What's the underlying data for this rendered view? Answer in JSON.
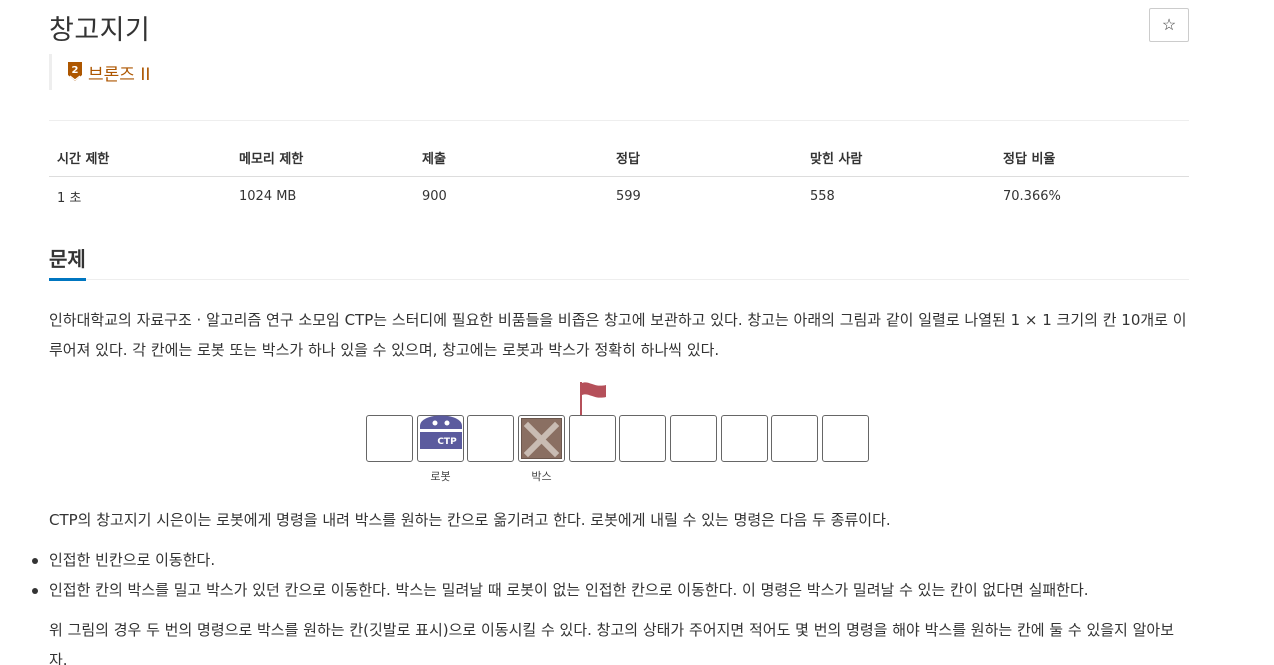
{
  "problem": {
    "title": "창고지기",
    "star_symbol": "☆",
    "tier": {
      "number": "2",
      "label": "브론즈 II",
      "color": "#ad5600"
    }
  },
  "info_table": {
    "headers": [
      "시간 제한",
      "메모리 제한",
      "제출",
      "정답",
      "맞힌 사람",
      "정답 비율"
    ],
    "values": [
      "1 초",
      "1024 MB",
      "900",
      "599",
      "558",
      "70.366%"
    ]
  },
  "section": {
    "title": "문제",
    "accent_color": "#0076c0"
  },
  "paragraphs": {
    "p1": "인하대학교의 자료구조 · 알고리즘 연구 소모임 CTP는 스터디에 필요한 비품들을 비좁은 창고에 보관하고 있다. 창고는 아래의 그림과 같이 일렬로 나열된 1 × 1 크기의 칸 10개로 이루어져 있다. 각 칸에는 로봇 또는 박스가 하나 있을 수 있으며, 창고에는 로봇과 박스가 정확히 하나씩 있다.",
    "p2": "CTP의 창고지기 시은이는 로봇에게 명령을 내려 박스를 원하는 칸으로 옮기려고 한다. 로봇에게 내릴 수 있는 명령은 다음 두 종류이다.",
    "p3": "위 그림의 경우 두 번의 명령으로 박스를 원하는 칸(깃발로 표시)으로 이동시킬 수 있다. 창고의 상태가 주어지면 적어도 몇 번의 명령을 해야 박스를 원하는 칸에 둘 수 있을지 알아보자."
  },
  "figure": {
    "cell_count": 10,
    "robot_cell": 2,
    "box_cell": 4,
    "flag_cell": 5,
    "robot_text": "CTP",
    "robot_label": "로봇",
    "box_label": "박스",
    "robot_color": "#5b5b9e",
    "box_color": "#8a6f62",
    "flag_color": "#b5505a"
  },
  "bullets": [
    "인접한 빈칸으로 이동한다.",
    "인접한 칸의 박스를 밀고 박스가 있던 칸으로 이동한다. 박스는 밀려날 때 로봇이 없는 인접한 칸으로 이동한다. 이 명령은 박스가 밀려날 수 있는 칸이 없다면 실패한다."
  ]
}
